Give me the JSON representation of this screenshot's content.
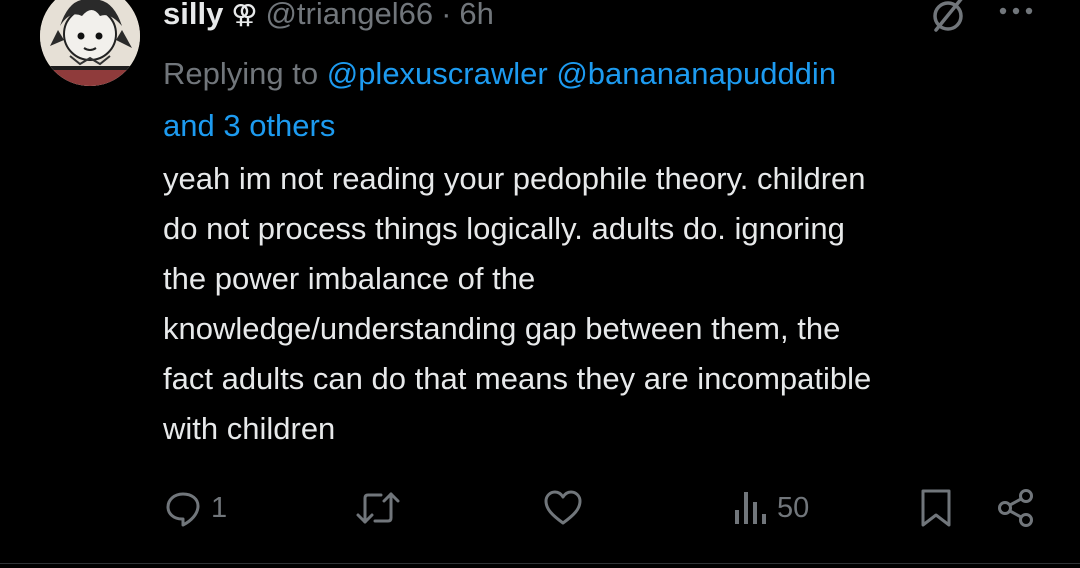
{
  "tweet": {
    "display_name": "silly",
    "name_symbol": "⚢",
    "handle": "@triangel66",
    "separator": "·",
    "time": "6h",
    "reply_prefix": "Replying to",
    "reply_mentions": [
      "@plexuscrawler",
      "@banananapudddin"
    ],
    "reply_suffix": "and 3 others",
    "text": "yeah im not reading your pedophile theory. children\ndo not process things logically. adults do. ignoring\nthe power imbalance of the\nknowledge/understanding gap between them, the\nfact adults can do that means they are incompatible\nwith children"
  },
  "actions": {
    "reply_count": "1",
    "retweet_count": "",
    "like_count": "",
    "views_count": "50"
  },
  "colors": {
    "background": "#000000",
    "text": "#e7e9ea",
    "muted": "#71767b",
    "accent": "#1d9bf0"
  },
  "icons": {
    "reply": "reply-icon",
    "retweet": "retweet-icon",
    "like": "heart-icon",
    "views": "views-icon",
    "bookmark": "bookmark-icon",
    "share": "share-icon",
    "grok": "grok-icon",
    "more": "more-icon"
  }
}
